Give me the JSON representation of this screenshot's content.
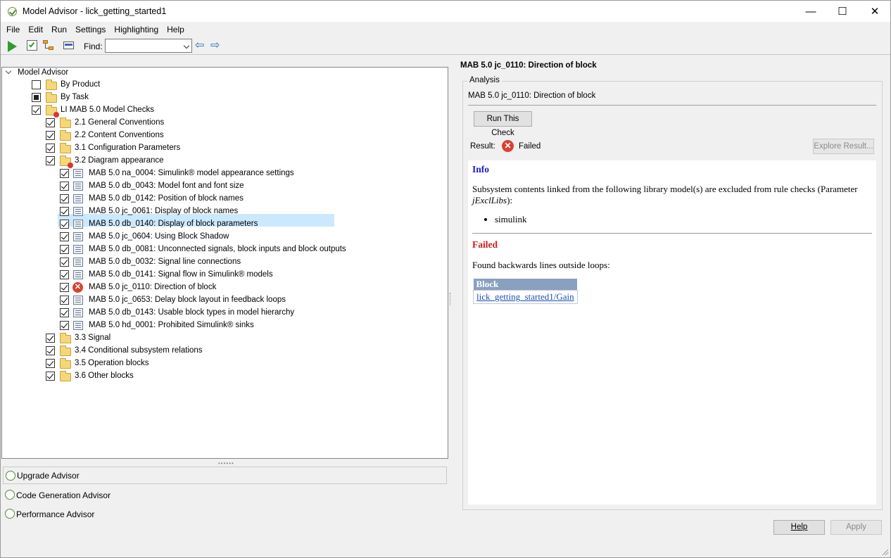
{
  "window": {
    "title": "Model Advisor - lick_getting_started1",
    "controls": {
      "minimize": "—",
      "maximize": "☐",
      "close": "✕"
    }
  },
  "menu": [
    "File",
    "Edit",
    "Run",
    "Settings",
    "Highlighting",
    "Help"
  ],
  "toolbar": {
    "find_label": "Find:",
    "find_value": "",
    "icons": [
      "run-icon",
      "run-checks-icon",
      "hierarchy-icon",
      "report-icon",
      "back-arrow-icon",
      "forward-arrow-icon"
    ]
  },
  "tree": {
    "root": "Model Advisor",
    "items": [
      {
        "label": "By Product",
        "check": "unchecked",
        "folder": true
      },
      {
        "label": "By Task",
        "check": "partial",
        "folder": true
      },
      {
        "label": "LI MAB 5.0 Model Checks",
        "check": "checked",
        "folder": true,
        "failed": true
      },
      {
        "label": "2.1 General Conventions",
        "check": "checked",
        "folder": true
      },
      {
        "label": "2.2 Content Conventions",
        "check": "checked",
        "folder": true
      },
      {
        "label": "3.1 Configuration Parameters",
        "check": "checked",
        "folder": true
      },
      {
        "label": "3.2 Diagram appearance",
        "check": "checked",
        "folder": true,
        "failed": true
      },
      {
        "label": "MAB 5.0 na_0004: Simulink® model appearance settings",
        "check": "checked"
      },
      {
        "label": "MAB 5.0 db_0043: Model font and font size",
        "check": "checked"
      },
      {
        "label": "MAB 5.0 db_0142: Position of block names",
        "check": "checked"
      },
      {
        "label": "MAB 5.0 jc_0061: Display of block names",
        "check": "checked"
      },
      {
        "label": "MAB 5.0 db_0140: Display of block parameters",
        "check": "checked"
      },
      {
        "label": "MAB 5.0 jc_0604: Using Block Shadow",
        "check": "checked"
      },
      {
        "label": "MAB 5.0 db_0081: Unconnected signals, block inputs and block outputs",
        "check": "checked"
      },
      {
        "label": "MAB 5.0 db_0032: Signal line connections",
        "check": "checked"
      },
      {
        "label": "MAB 5.0 db_0141: Signal flow in Simulink® models",
        "check": "checked"
      },
      {
        "label": "MAB 5.0 jc_0110: Direction of block",
        "check": "checked",
        "failed": true,
        "selected": true
      },
      {
        "label": "MAB 5.0 jc_0653: Delay block layout in feedback loops",
        "check": "checked"
      },
      {
        "label": "MAB 5.0 db_0143: Usable block types in model hierarchy",
        "check": "checked"
      },
      {
        "label": "MAB 5.0 hd_0001: Prohibited Simulink® sinks",
        "check": "checked"
      },
      {
        "label": "3.3 Signal",
        "check": "checked",
        "folder": true
      },
      {
        "label": "3.4 Conditional subsystem relations",
        "check": "checked",
        "folder": true
      },
      {
        "label": "3.5 Operation blocks",
        "check": "checked",
        "folder": true
      },
      {
        "label": "3.6 Other blocks",
        "check": "checked",
        "folder": true
      }
    ]
  },
  "advisors": [
    "Upgrade Advisor",
    "Code Generation Advisor",
    "Performance Advisor"
  ],
  "detail": {
    "title": "MAB 5.0 jc_0110: Direction of block",
    "analysis_legend": "Analysis",
    "check_name": "MAB 5.0 jc_0110: Direction of block",
    "run_button": "Run This Check",
    "result_label": "Result:",
    "result_value": "Failed",
    "explore_button": "Explore Result...",
    "report": {
      "info_heading": "Info",
      "info_text_1": "Subsystem contents linked from the following library model(s) are excluded from rule checks (Parameter ",
      "info_param": "jExclLibs",
      "info_text_2": "):",
      "libraries": [
        "simulink"
      ],
      "failed_heading": "Failed",
      "failed_text": "Found backwards lines outside loops:",
      "table_header": "Block",
      "table_rows": [
        "lick_getting_started1/Gain"
      ]
    }
  },
  "buttons": {
    "help": "Help",
    "apply": "Apply"
  },
  "colors": {
    "selection": "#cce8ff",
    "fail": "#d9412f",
    "info_heading": "#1a1acc",
    "failed_heading": "#d01a1a"
  }
}
